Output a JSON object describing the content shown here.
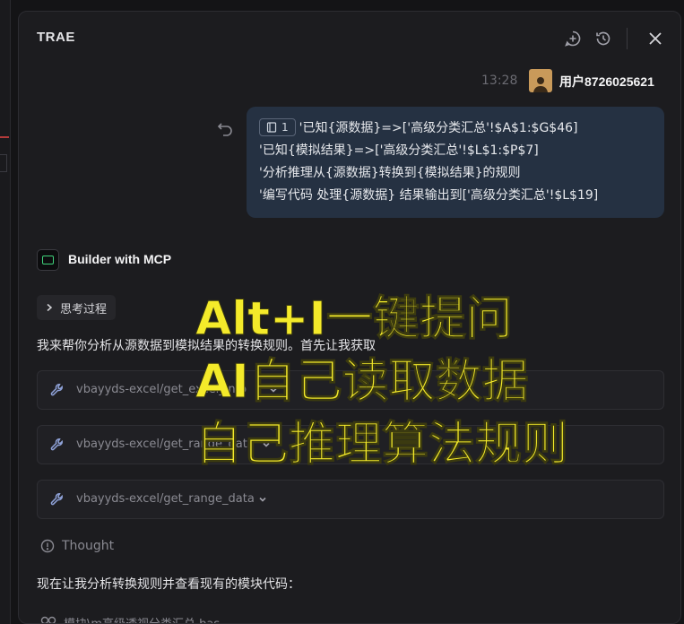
{
  "app": {
    "brand": "TRAE"
  },
  "message": {
    "time": "13:28",
    "username": "用户8726025621",
    "context_chip": "1",
    "lines": [
      "'已知{源数据}=>['高级分类汇总'!$A$1:$G$46]",
      "'已知{模拟结果}=>['高级分类汇总'!$L$1:$P$7]",
      "'分析推理从{源数据}转换到{模拟结果}的规则",
      "'编写代码 处理{源数据} 结果输出到['高级分类汇总'!$L$19]"
    ]
  },
  "agent": {
    "name": "Builder with MCP",
    "thinking_label": "思考过程"
  },
  "reply": {
    "text": "我来帮你分析从源数据到模拟结果的转换规则。首先让我获取",
    "tools": [
      {
        "name": "vbayyds-excel/get_excel_info"
      },
      {
        "name": "vbayyds-excel/get_range_data"
      },
      {
        "name": "vbayyds-excel/get_range_data"
      }
    ],
    "thought_label": "Thought",
    "text2": "现在让我分析转换规则并查看现有的模块代码：",
    "file": "模块\\m高级透视分类汇总.bas"
  },
  "overlay": {
    "lines": [
      "Alt+I一键提问",
      "AI自己读取数据",
      "自己推理算法规则"
    ],
    "color": "#f4ea2a"
  },
  "icons": [
    "new-chat-icon",
    "history-icon",
    "close-icon",
    "undo-icon",
    "wrench-icon",
    "chevron-down-icon",
    "info-icon",
    "link-icon"
  ]
}
